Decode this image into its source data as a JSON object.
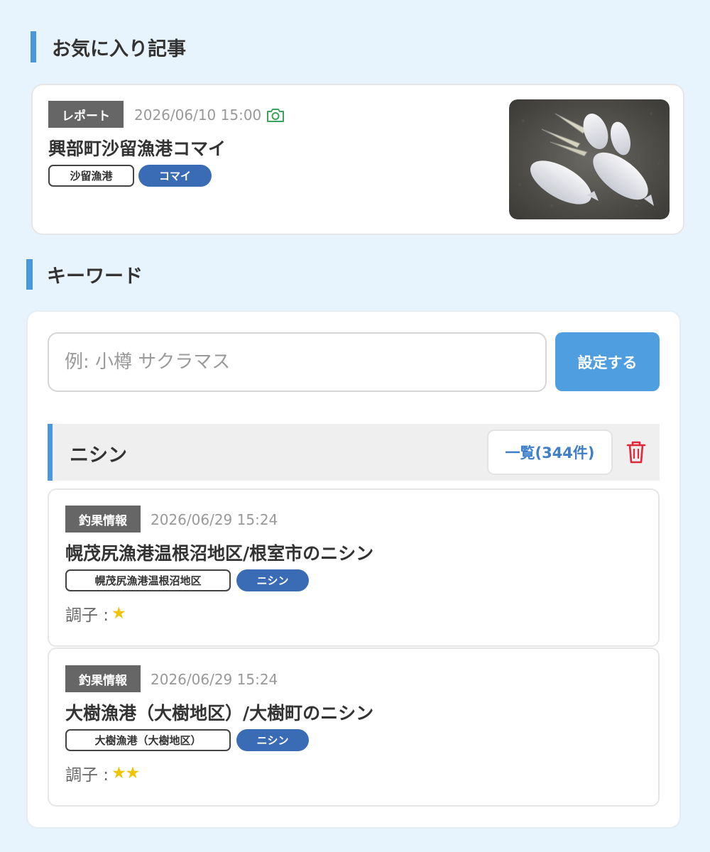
{
  "favorites": {
    "heading": "お気に入り記事",
    "article": {
      "badge": "レポート",
      "date": "2026/06/10 15:00",
      "has_photo_icon": "camera-icon",
      "title": "興部町沙留漁港コマイ",
      "tags": [
        "沙留漁港",
        "コマイ"
      ],
      "thumbnail": "caught-fish-photo"
    }
  },
  "keyword": {
    "heading": "キーワード",
    "input_placeholder": "例: 小樽 サクラマス",
    "input_value": "",
    "set_button": "設定する",
    "registered": {
      "name": "ニシン",
      "list_button": "一覧(344件)",
      "delete_icon": "trash-icon"
    },
    "results": [
      {
        "badge": "釣果情報",
        "date": "2026/06/29 15:24",
        "title": "幌茂尻漁港温根沼地区/根室市のニシン",
        "tags": [
          "幌茂尻漁港温根沼地区",
          "ニシン"
        ],
        "condition_label": "調子 :",
        "stars": "★"
      },
      {
        "badge": "釣果情報",
        "date": "2026/06/29 15:24",
        "title": "大樹漁港（大樹地区）/大樹町のニシン",
        "tags": [
          "大樹漁港（大樹地区）",
          "ニシン"
        ],
        "condition_label": "調子 :",
        "stars": "★★"
      }
    ]
  },
  "colors": {
    "background": "#e8f4fd",
    "accent": "#4a97dc",
    "tag_blue": "#3a6cb6",
    "badge_gray": "#666666",
    "star": "#f0c400",
    "delete_red": "#e0283a"
  }
}
